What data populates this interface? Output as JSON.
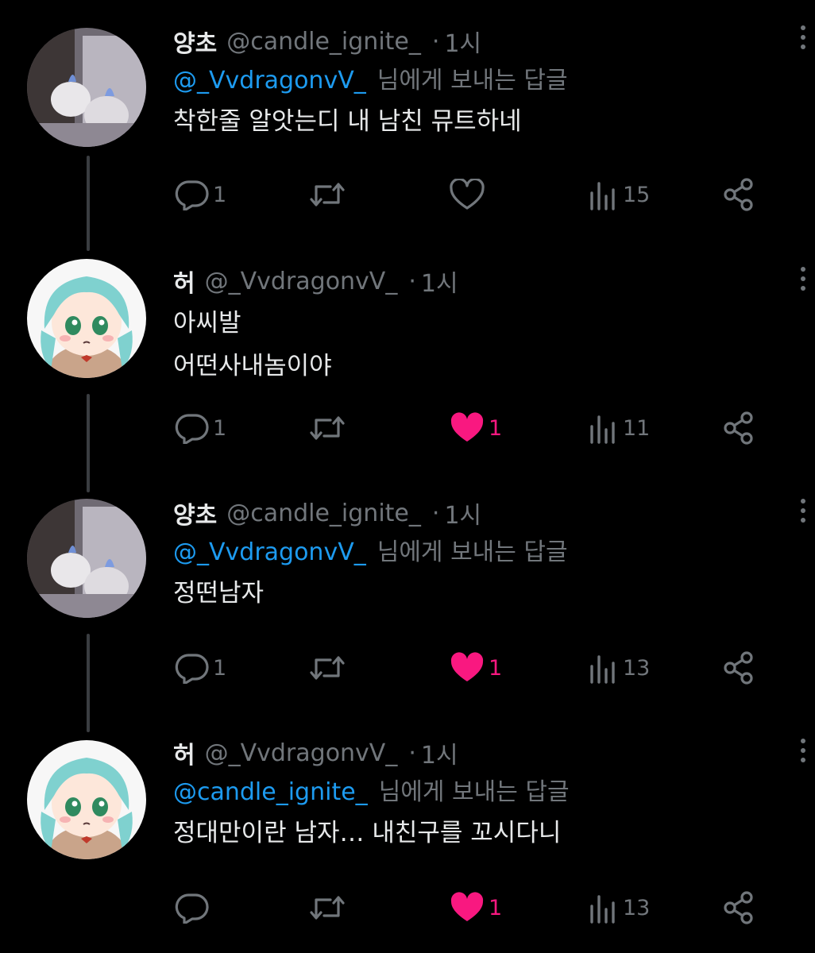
{
  "tweets": [
    {
      "avatar": "candle-avatar",
      "display_name": "양초",
      "handle": "@candle_ignite_",
      "dot": "·",
      "time": "1시",
      "reply_to_handle": "@_VvdragonvV_",
      "reply_to_suffix": "님에게 보내는 답글",
      "text_lines": [
        "착한줄 알앗는디 내 남친 뮤트하네"
      ],
      "reply_count": "1",
      "retweet_count": "",
      "like_count": "",
      "liked": false,
      "view_count": "15"
    },
    {
      "avatar": "anime-girl-avatar",
      "display_name": "허",
      "handle": "@_VvdragonvV_",
      "dot": "·",
      "time": "1시",
      "reply_to_handle": "",
      "reply_to_suffix": "",
      "text_lines": [
        "아씨발",
        "어떤사내놈이야"
      ],
      "reply_count": "1",
      "retweet_count": "",
      "like_count": "1",
      "liked": true,
      "view_count": "11"
    },
    {
      "avatar": "candle-avatar",
      "display_name": "양초",
      "handle": "@candle_ignite_",
      "dot": "·",
      "time": "1시",
      "reply_to_handle": "@_VvdragonvV_",
      "reply_to_suffix": "님에게 보내는 답글",
      "text_lines": [
        "정떤남자"
      ],
      "reply_count": "1",
      "retweet_count": "",
      "like_count": "1",
      "liked": true,
      "view_count": "13"
    },
    {
      "avatar": "anime-girl-avatar",
      "display_name": "허",
      "handle": "@_VvdragonvV_",
      "dot": "·",
      "time": "1시",
      "reply_to_handle": "@candle_ignite_",
      "reply_to_suffix": "님에게 보내는 답글",
      "text_lines": [
        "정대만이란 남자… 내친구를 꼬시다니"
      ],
      "reply_count": "",
      "retweet_count": "",
      "like_count": "1",
      "liked": true,
      "view_count": "13"
    }
  ],
  "colors": {
    "background": "#000000",
    "text": "#e7e9ea",
    "muted": "#71767b",
    "mention": "#1d9bf0",
    "like": "#f91880",
    "thread_line": "#3a3d41"
  },
  "icons": [
    "reply-icon",
    "retweet-icon",
    "like-icon",
    "views-icon",
    "share-icon",
    "more-icon"
  ]
}
